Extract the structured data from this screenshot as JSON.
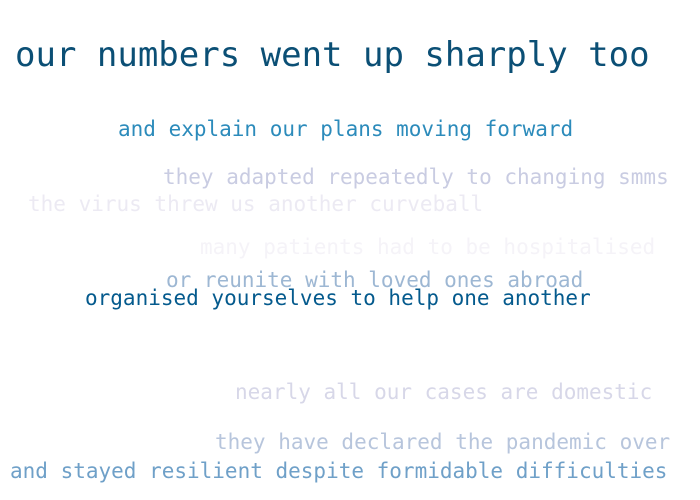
{
  "phrases": [
    {
      "text": "our numbers went up sharply too",
      "color": "#0b4f75"
    },
    {
      "text": "and explain our plans moving forward",
      "color": "#2c8bbb"
    },
    {
      "text": "they adapted repeatedly to changing smms",
      "color": "#c9cce2"
    },
    {
      "text": "the virus threw us another curveball",
      "color": "#eceaf3"
    },
    {
      "text": "many patients had to be hospitalised",
      "color": "#f5f3f8"
    },
    {
      "text": "or reunite with loved ones abroad",
      "color": "#9db7d3"
    },
    {
      "text": "organised yourselves to help one another",
      "color": "#045a8d"
    },
    {
      "text": "nearly all our cases are domestic",
      "color": "#d7d7e8"
    },
    {
      "text": "they have declared the pandemic over",
      "color": "#b7c5dc"
    },
    {
      "text": "and stayed resilient despite formidable difficulties",
      "color": "#6fa0c8"
    }
  ]
}
